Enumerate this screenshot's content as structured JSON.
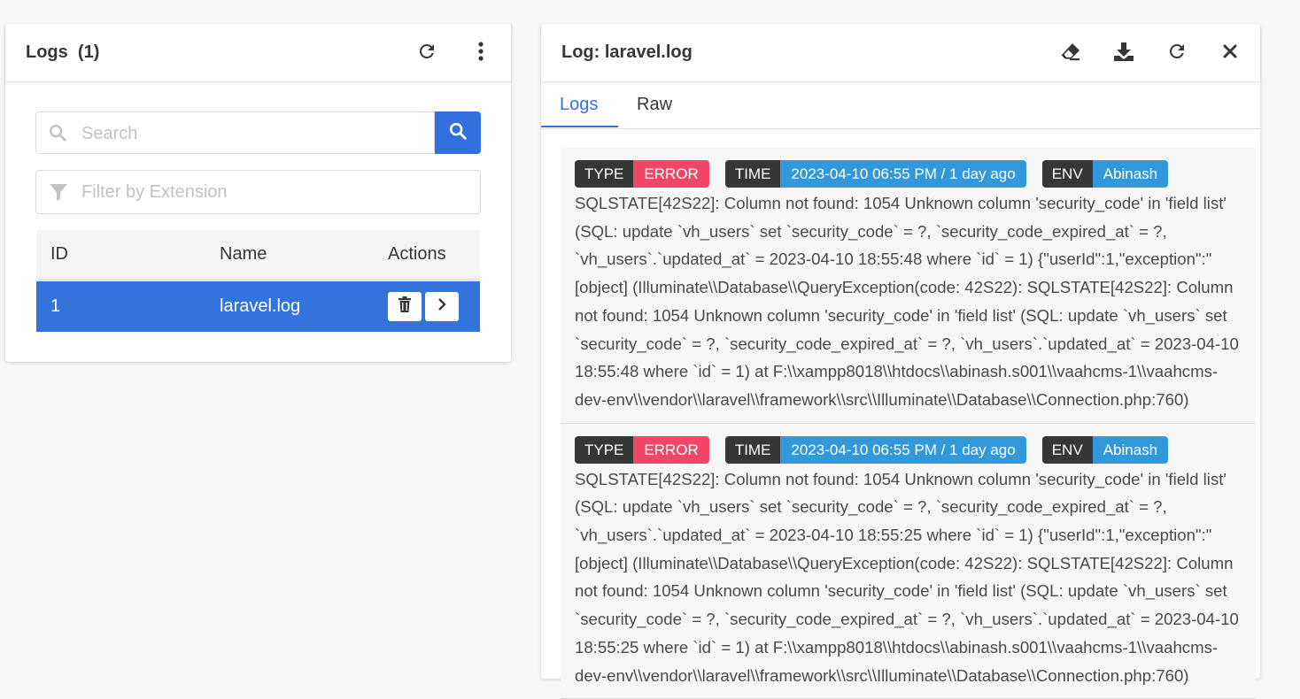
{
  "left_panel": {
    "title": "Logs",
    "count": "(1)",
    "search_placeholder": "Search",
    "filter_placeholder": "Filter by Extension",
    "table": {
      "headers": [
        "ID",
        "Name",
        "Actions"
      ],
      "rows": [
        {
          "id": "1",
          "name": "laravel.log"
        }
      ]
    }
  },
  "right_panel": {
    "title": "Log: laravel.log",
    "tabs": [
      {
        "label": "Logs",
        "active": true
      },
      {
        "label": "Raw",
        "active": false
      }
    ],
    "entries": [
      {
        "type_key": "TYPE",
        "type_value": "ERROR",
        "time_key": "TIME",
        "time_value": "2023-04-10 06:55 PM / 1 day ago",
        "env_key": "ENV",
        "env_value": "Abinash",
        "message": "SQLSTATE[42S22]: Column not found: 1054 Unknown column 'security_code' in 'field list' (SQL: update `vh_users` set `security_code` = ?, `security_code_expired_at` = ?, `vh_users`.`updated_at` = 2023-04-10 18:55:48 where `id` = 1) {\"userId\":1,\"exception\":\"[object] (Illuminate\\\\Database\\\\QueryException(code: 42S22): SQLSTATE[42S22]: Column not found: 1054 Unknown column 'security_code' in 'field list' (SQL: update `vh_users` set `security_code` = ?, `security_code_expired_at` = ?, `vh_users`.`updated_at` = 2023-04-10 18:55:48 where `id` = 1) at F:\\\\xampp8018\\\\htdocs\\\\abinash.s001\\\\vaahcms-1\\\\vaahcms-dev-env\\\\vendor\\\\laravel\\\\framework\\\\src\\\\Illuminate\\\\Database\\\\Connection.php:760)"
      },
      {
        "type_key": "TYPE",
        "type_value": "ERROR",
        "time_key": "TIME",
        "time_value": "2023-04-10 06:55 PM / 1 day ago",
        "env_key": "ENV",
        "env_value": "Abinash",
        "message": "SQLSTATE[42S22]: Column not found: 1054 Unknown column 'security_code' in 'field list' (SQL: update `vh_users` set `security_code` = ?, `security_code_expired_at` = ?, `vh_users`.`updated_at` = 2023-04-10 18:55:25 where `id` = 1) {\"userId\":1,\"exception\":\"[object] (Illuminate\\\\Database\\\\QueryException(code: 42S22): SQLSTATE[42S22]: Column not found: 1054 Unknown column 'security_code' in 'field list' (SQL: update `vh_users` set `security_code` = ?, `security_code_expired_at` = ?, `vh_users`.`updated_at` = 2023-04-10 18:55:25 where `id` = 1) at F:\\\\xampp8018\\\\htdocs\\\\abinash.s001\\\\vaahcms-1\\\\vaahcms-dev-env\\\\vendor\\\\laravel\\\\framework\\\\src\\\\Illuminate\\\\Database\\\\Connection.php:760)"
      }
    ]
  },
  "colors": {
    "accent": "#3273dc",
    "danger": "#f14668",
    "info": "#3298dc",
    "dark": "#363636"
  },
  "icons": [
    "refresh-icon",
    "more-vertical-icon",
    "search-icon",
    "filter-icon",
    "trash-icon",
    "chevron-right-icon",
    "eraser-icon",
    "download-icon",
    "close-icon"
  ]
}
